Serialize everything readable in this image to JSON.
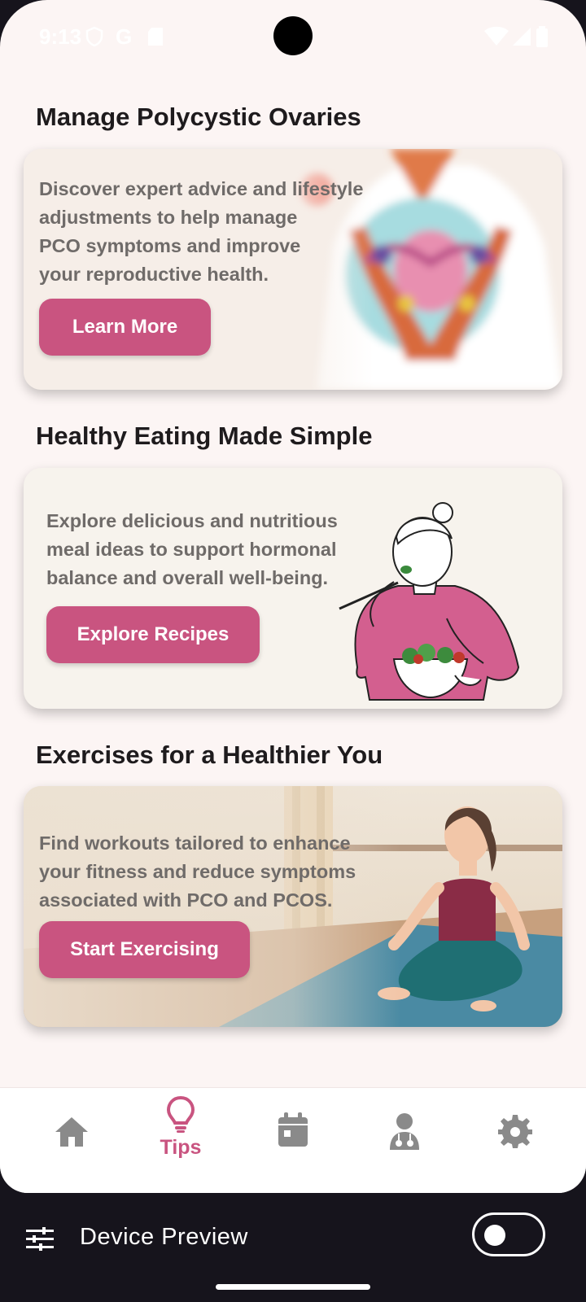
{
  "status_bar": {
    "time": "9:13",
    "g_label": "G"
  },
  "sections": [
    {
      "title": "Manage Polycystic Ovaries",
      "description": "Discover expert advice and lifestyle\nadjustments to help manage\nPCO symptoms and improve\nyour reproductive health.",
      "button": "Learn More"
    },
    {
      "title": "Healthy Eating Made Simple",
      "description": "Explore delicious and nutritious\nmeal ideas to support hormonal\nbalance and overall well-being.",
      "button": "Explore Recipes"
    },
    {
      "title": "Exercises for a Healthier You",
      "description": "Find workouts tailored to enhance\n your fitness and reduce symptoms\n associated with PCO and PCOS.",
      "button": "Start Exercising"
    }
  ],
  "bottom_nav": {
    "items": [
      {
        "icon": "home-icon",
        "label": ""
      },
      {
        "icon": "lightbulb-icon",
        "label": "Tips",
        "active": true
      },
      {
        "icon": "calendar-icon",
        "label": ""
      },
      {
        "icon": "doctor-icon",
        "label": ""
      },
      {
        "icon": "gear-icon",
        "label": ""
      }
    ],
    "active_color": "#c95480",
    "inactive_color": "#8a8a8a"
  },
  "device_preview": {
    "label": "Device Preview",
    "toggle_on": false
  },
  "colors": {
    "accent": "#c95480",
    "background": "#fcf5f4",
    "card": "#f7f2ec"
  }
}
